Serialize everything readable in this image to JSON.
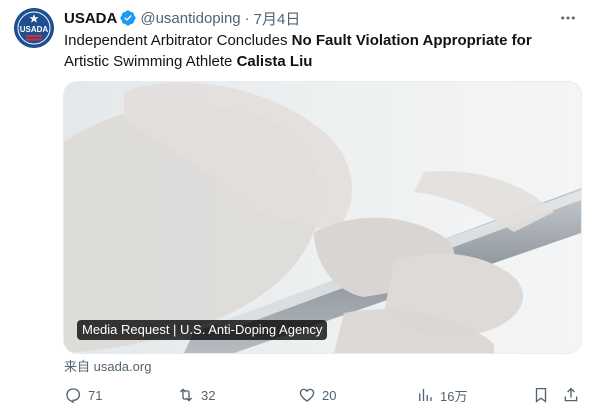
{
  "account": {
    "display_name": "USADA",
    "handle": "@usantidoping",
    "date": "7月4日",
    "avatar_text": "USADA"
  },
  "tweet": {
    "text_1": "Independent Arbitrator Concludes ",
    "text_bold_1": "No Fault Violation Appropriate for",
    "text_2": "Artistic Swimming Athlete ",
    "text_bold_2": "Calista Liu"
  },
  "card": {
    "label": "Media Request | U.S. Anti-Doping Agency",
    "source": "来自 usada.org"
  },
  "actions": {
    "replies": "71",
    "retweets": "32",
    "likes": "20",
    "views": "16万"
  },
  "colors": {
    "text_primary": "#0f1419",
    "text_secondary": "#536471",
    "verified": "#1d9bf0",
    "avatar_bg": "#1d4f91"
  }
}
